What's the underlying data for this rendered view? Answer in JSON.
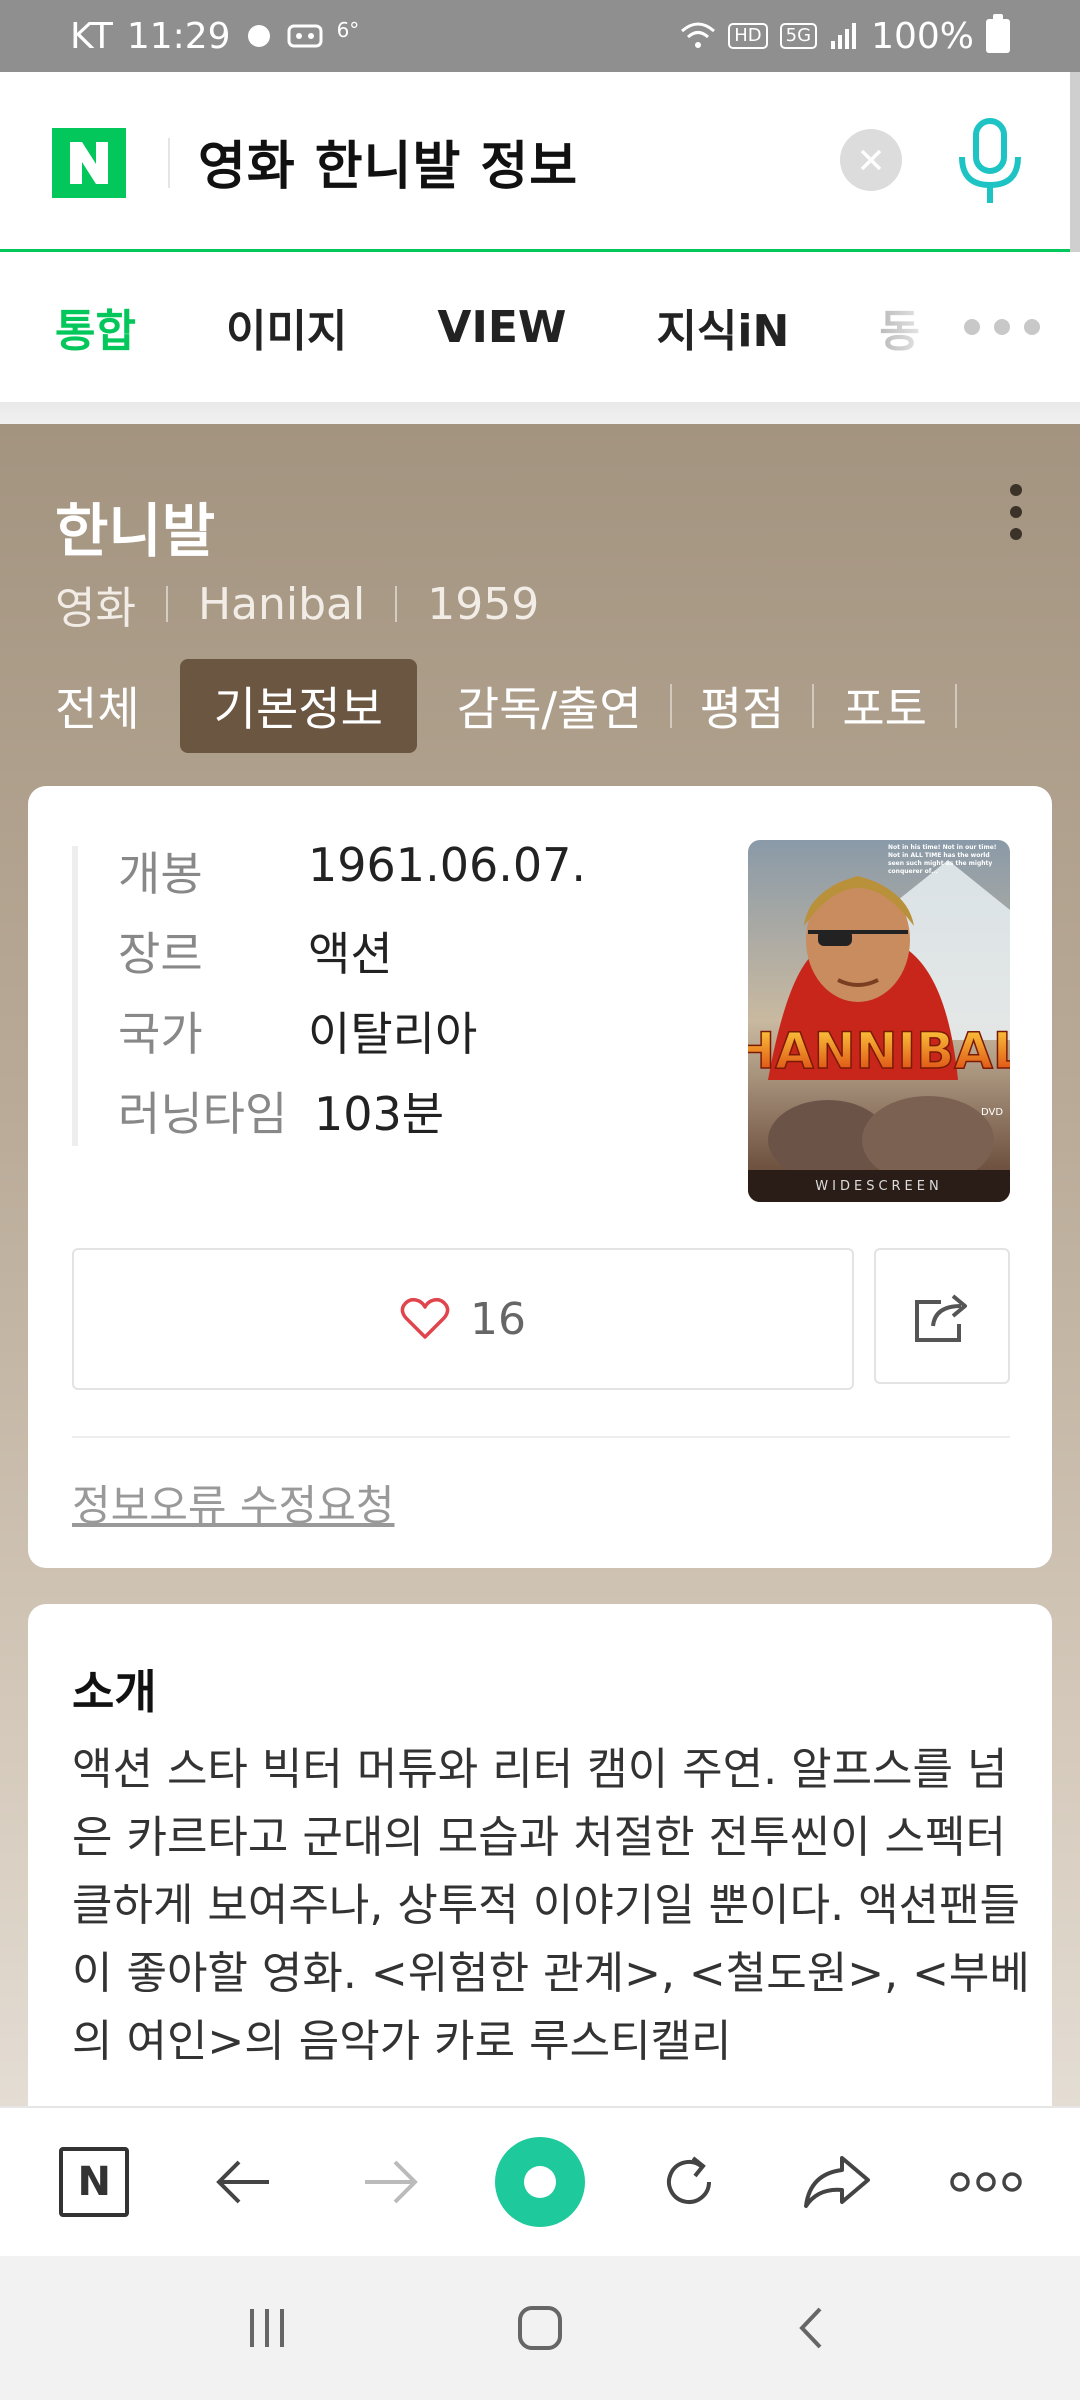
{
  "status_bar": {
    "carrier": "KT",
    "time": "11:29",
    "temperature": "6°",
    "network_hd": "HD",
    "network_5g": "5G",
    "battery": "100%"
  },
  "search": {
    "logo": "N",
    "query": "영화 한니발 정보",
    "clear_icon": "close-icon",
    "mic_icon": "microphone-icon",
    "colors": {
      "brand": "#03c75a"
    }
  },
  "tabs": [
    {
      "label": "통합",
      "active": true
    },
    {
      "label": "이미지"
    },
    {
      "label": "VIEW"
    },
    {
      "label": "지식iN"
    },
    {
      "label": "동"
    }
  ],
  "movie": {
    "title": "한니발",
    "category": "영화",
    "original_title": "Hanibal",
    "year": "1959",
    "subtabs": [
      "전체",
      "기본정보",
      "감독/출연",
      "평점",
      "포토"
    ],
    "active_subtab": "기본정보",
    "info": [
      {
        "key": "개봉",
        "value": "1961.06.07."
      },
      {
        "key": "장르",
        "value": "액션"
      },
      {
        "key": "국가",
        "value": "이탈리아"
      },
      {
        "key": "러닝타임",
        "value": "103분"
      }
    ],
    "poster": {
      "title": "HANNIBAL",
      "tagline": "Not in his time! Not in our time! Not in ALL TIME has the world seen such might as the mighty conquerer of...",
      "footer": "WIDESCREEN",
      "badge": "DVD"
    },
    "likes": "16",
    "report_link": "정보오류 수정요청"
  },
  "intro": {
    "title": "소개",
    "text": "액션 스타 빅터 머튜와 리터 캠이 주연. 알프스를 넘은 카르타고 군대의 모습과 처절한 전투씬이 스펙터클하게 보여주나, 상투적 이야기일 뿐이다. 액션팬들이 좋아할 영화. <위험한 관계>, <철도원>, <부베의 여인>의 음악가 카로 루스티캘리"
  },
  "browser_toolbar": {
    "home_logo": "N",
    "icons": [
      "naver-home-icon",
      "back-arrow-icon",
      "forward-arrow-icon",
      "green-dot-icon",
      "refresh-icon",
      "share-arrow-icon",
      "more-icon"
    ]
  },
  "nav": {
    "icons": [
      "recent-apps-icon",
      "home-icon",
      "back-icon"
    ]
  }
}
